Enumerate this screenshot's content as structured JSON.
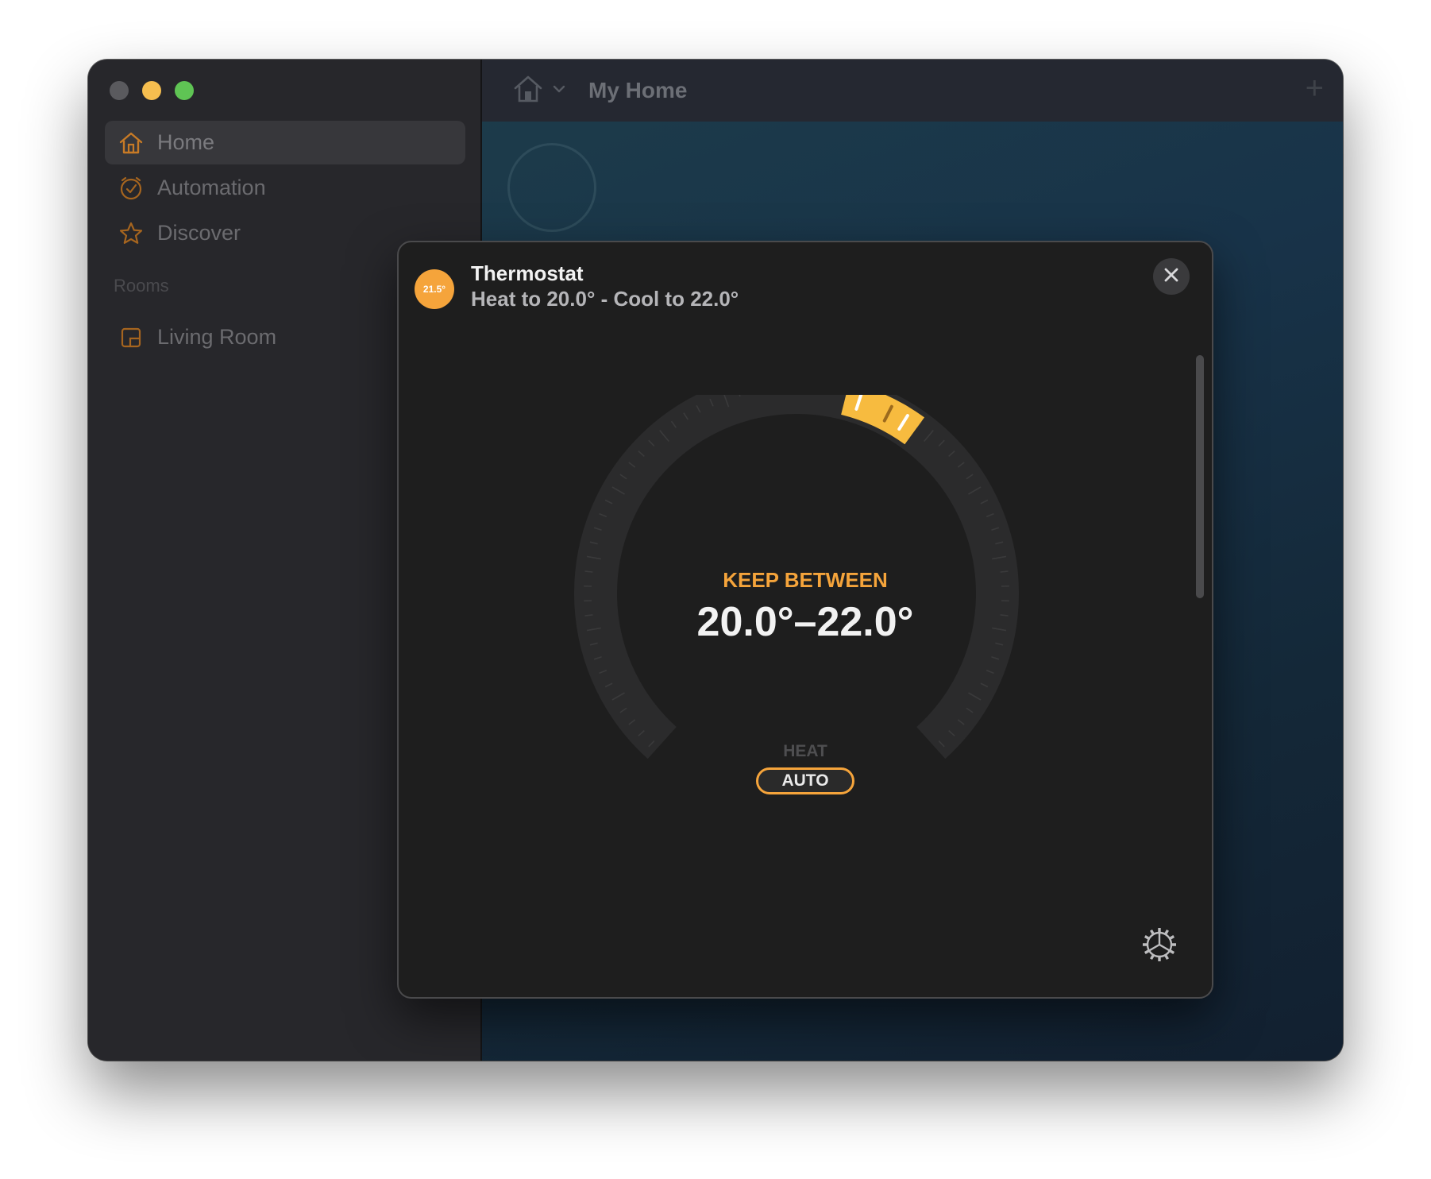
{
  "sidebar": {
    "items": [
      {
        "label": "Home",
        "icon": "house-icon"
      },
      {
        "label": "Automation",
        "icon": "clock-icon"
      },
      {
        "label": "Discover",
        "icon": "star-icon"
      }
    ],
    "rooms_header": "Rooms",
    "rooms": [
      {
        "label": "Living Room",
        "icon": "room-icon"
      }
    ]
  },
  "toolbar": {
    "title": "My Home",
    "add_label": "+"
  },
  "modal": {
    "badge": "21.5°",
    "title": "Thermostat",
    "subtitle": "Heat to 20.0° - Cool to 22.0°",
    "dial_label": "KEEP BETWEEN",
    "dial_value": "20.0°–22.0°",
    "modes": [
      "HEAT",
      "AUTO"
    ],
    "selected_mode": "AUTO"
  },
  "colors": {
    "accent": "#f5a43b",
    "handle": "#f7bb3f"
  }
}
